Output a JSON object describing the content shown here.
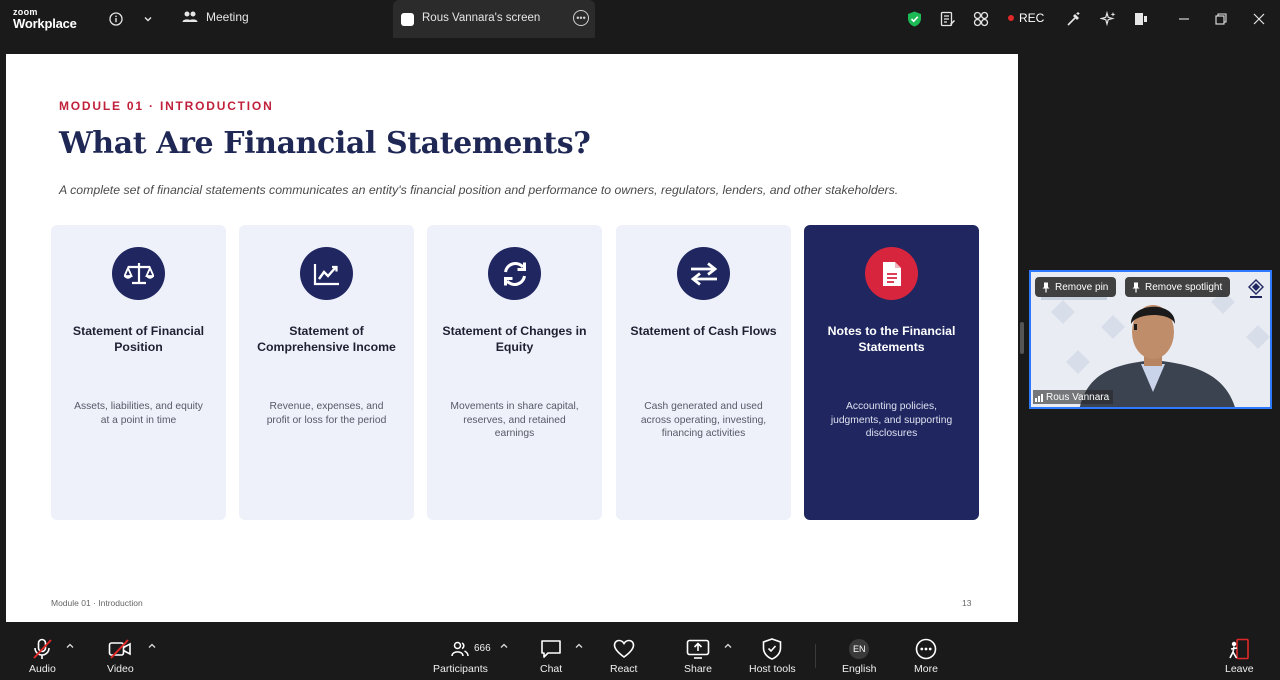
{
  "app": {
    "logo_small": "zoom",
    "logo_large": "Workplace"
  },
  "topbar": {
    "meeting_label": "Meeting",
    "screen_tab_label": "Rous Vannara's screen",
    "rec_label": "REC"
  },
  "slide": {
    "kicker": "MODULE 01 · INTRODUCTION",
    "title": "What Are Financial Statements?",
    "subtitle": "A complete set of financial statements communicates an entity's financial position and performance to owners, regulators, lenders, and other stakeholders.",
    "cards": [
      {
        "icon": "scale-icon",
        "title": "Statement of Financial Position",
        "desc": "Assets, liabilities, and equity at a point in time"
      },
      {
        "icon": "trend-chart-icon",
        "title": "Statement of Comprehensive Income",
        "desc": "Revenue, expenses, and profit or loss for the period"
      },
      {
        "icon": "refresh-icon",
        "title": "Statement of Changes in Equity",
        "desc": "Movements in share capital, reserves, and retained earnings"
      },
      {
        "icon": "exchange-arrows-icon",
        "title": "Statement of Cash Flows",
        "desc": "Cash generated and used across operating, investing, financing activities"
      },
      {
        "icon": "document-icon",
        "title": "Notes to the Financial Statements",
        "desc": "Accounting policies, judgments, and supporting disclosures"
      }
    ],
    "footer_left": "Module 01 · Introduction",
    "page_number": "13"
  },
  "video": {
    "remove_pin": "Remove pin",
    "remove_spotlight": "Remove spotlight",
    "participant_name": "Rous Vannara"
  },
  "toolbar": {
    "audio": "Audio",
    "video": "Video",
    "participants": "Participants",
    "participants_count": "666",
    "chat": "Chat",
    "react": "React",
    "share": "Share",
    "host_tools": "Host tools",
    "language_badge": "EN",
    "language": "English",
    "more": "More",
    "leave": "Leave"
  },
  "colors": {
    "accent_red": "#c0203a",
    "navy": "#1f2660",
    "card_bg": "#eef1fa",
    "shield_green": "#1db954",
    "rec_red": "#e02828"
  }
}
